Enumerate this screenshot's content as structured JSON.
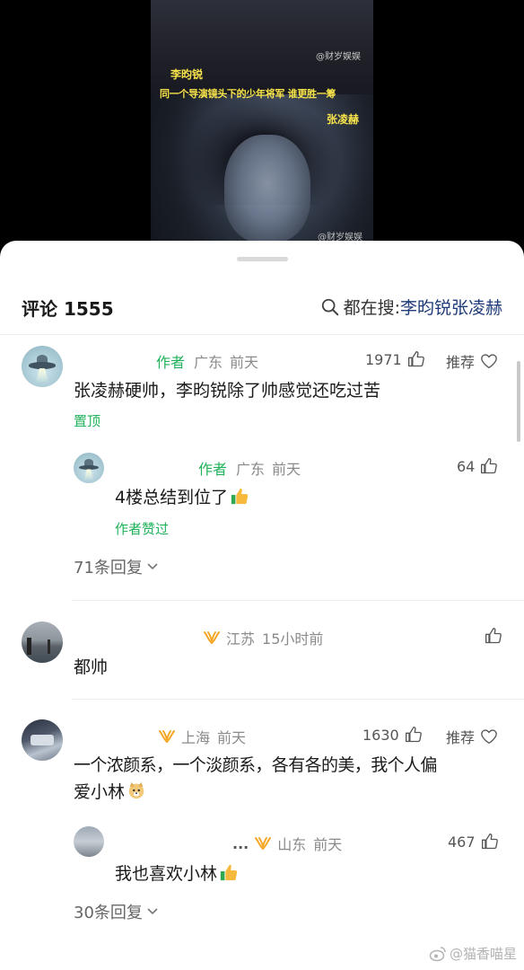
{
  "video": {
    "watermark_top": "@财岁娱娱",
    "watermark_bottom": "@财岁娱娱",
    "caption_name1": "李昀锐",
    "caption_line": "同一个导演镜头下的少年将军 谁更胜一筹",
    "caption_name2": "张凌赫"
  },
  "header": {
    "title": "评论 1555",
    "search_prefix": "都在搜:",
    "search_term": "李昀锐张凌赫",
    "search_icon": "search-icon"
  },
  "comments": [
    {
      "author_tag": "作者",
      "location": "广东",
      "time": "前天",
      "likes": "1971",
      "recommend": "推荐",
      "text": "张凌赫硬帅，李昀锐除了帅感觉还吃过苦",
      "tag": "置顶",
      "reply": {
        "author_tag": "作者",
        "location": "广东",
        "time": "前天",
        "likes": "64",
        "text": "4楼总结到位了",
        "tag": "作者赞过"
      },
      "replies_link": "71条回复"
    },
    {
      "location": "江苏",
      "time": "15小时前",
      "text": "都帅"
    },
    {
      "location": "上海",
      "time": "前天",
      "likes": "1630",
      "recommend": "推荐",
      "text_line1": "一个浓颜系，一个淡颜系，各有各的美，我个人偏",
      "text_line2": "爱小林",
      "reply": {
        "ellipsis": "...",
        "location": "山东",
        "time": "前天",
        "likes": "467",
        "text": "我也喜欢小林"
      },
      "replies_link": "30条回复"
    }
  ],
  "watermark": "@猫香喵星",
  "colors": {
    "green": "#1fb25a",
    "search_blue": "#1f3a78",
    "vip_orange": "#f5a623"
  }
}
